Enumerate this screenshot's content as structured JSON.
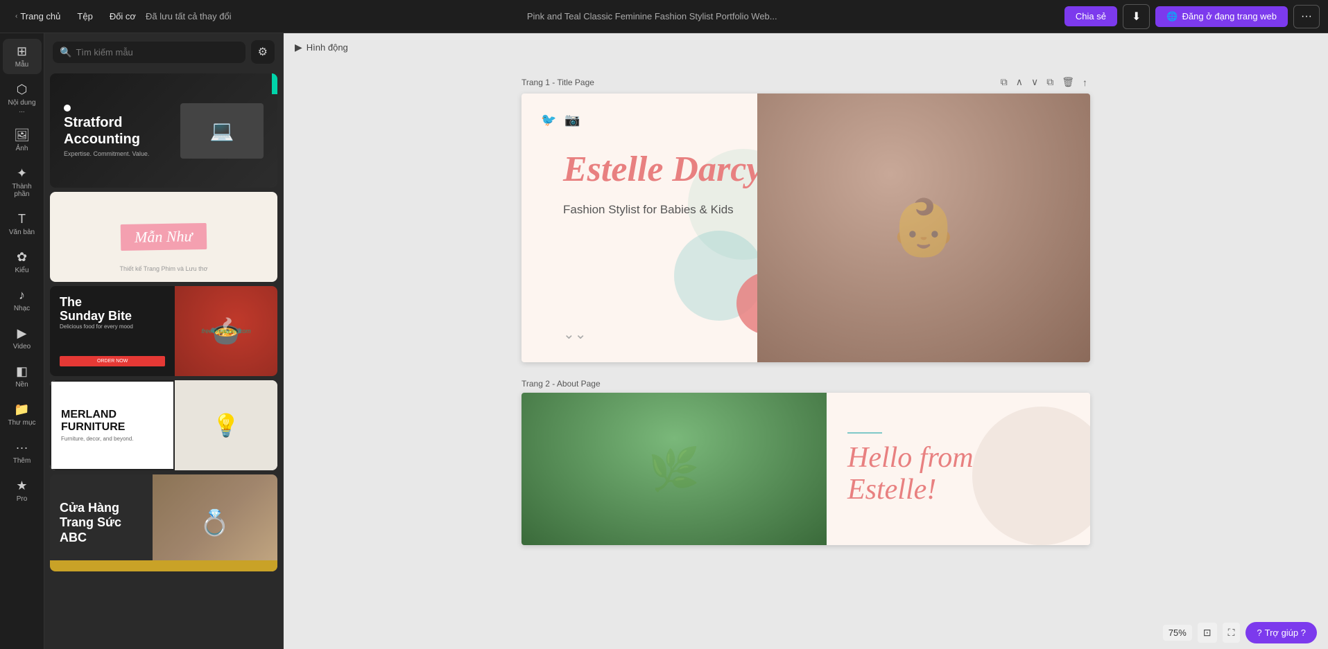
{
  "topbar": {
    "home_label": "Trang chủ",
    "file_label": "Tệp",
    "adjust_label": "Đối cơ",
    "autosave_label": "Đã lưu tất cả thay đổi",
    "title": "Pink and Teal Classic Feminine Fashion Stylist Portfolio Web...",
    "share_label": "Chia sẻ",
    "publish_label": "Đăng ở đạng trang web",
    "more_icon": "···"
  },
  "sidebar": {
    "items": [
      {
        "id": "mau",
        "label": "Mẫu",
        "icon": "⊞"
      },
      {
        "id": "noi-dung",
        "label": "Nội dung ...",
        "icon": "⬡"
      },
      {
        "id": "anh",
        "label": "Ảnh",
        "icon": "🖼"
      },
      {
        "id": "thanh-phan",
        "label": "Thành phần",
        "icon": "✦"
      },
      {
        "id": "van-ban",
        "label": "Văn bản",
        "icon": "T"
      },
      {
        "id": "kieu",
        "label": "Kiểu",
        "icon": "✿"
      },
      {
        "id": "nhac",
        "label": "Nhạc",
        "icon": "♪"
      },
      {
        "id": "video",
        "label": "Video",
        "icon": "▶"
      },
      {
        "id": "nen",
        "label": "Nền",
        "icon": "◧"
      },
      {
        "id": "thu-muc",
        "label": "Thư mục",
        "icon": "📁"
      },
      {
        "id": "them",
        "label": "Thêm",
        "icon": "···"
      },
      {
        "id": "pro",
        "label": "Pro",
        "icon": "★"
      }
    ]
  },
  "search": {
    "placeholder": "Tìm kiếm mẫu"
  },
  "templates": [
    {
      "id": "stratford",
      "title": "Stratford",
      "subtitle": "Accounting",
      "sub2": "Expertise. Commitment. Value."
    },
    {
      "id": "man-nhu",
      "title": "Mẫn Như",
      "subtitle": "Thiết kế Trang Phim và Lưu thơ"
    },
    {
      "id": "sunday-bite",
      "title": "The Sunday Bite",
      "subtitle": "Delicious food for every mood",
      "btn_label": "ORDER NOW"
    },
    {
      "id": "merland",
      "title": "MERLAND",
      "subtitle": "FURNITURE",
      "sub2": "Furniture, decor, and beyond."
    },
    {
      "id": "cua-hang",
      "title": "Cửa Hàng",
      "subtitle": "Trang Sức",
      "sub2": "ABC"
    }
  ],
  "canvas": {
    "animation_label": "Hình động",
    "pages": [
      {
        "id": "page1",
        "label": "Trang 1 - Title Page",
        "content": {
          "title": "Estelle Darcy",
          "subtitle": "Fashion Stylist for Babies & Kids"
        }
      },
      {
        "id": "page2",
        "label": "Trang 2 - About Page",
        "content": {
          "title": "Hello from",
          "title2": "Estelle!"
        }
      }
    ]
  },
  "bottom": {
    "zoom": "75%",
    "help_label": "Trợ giúp ?",
    "help_icon": "?"
  },
  "watermark": "freePremium.com"
}
